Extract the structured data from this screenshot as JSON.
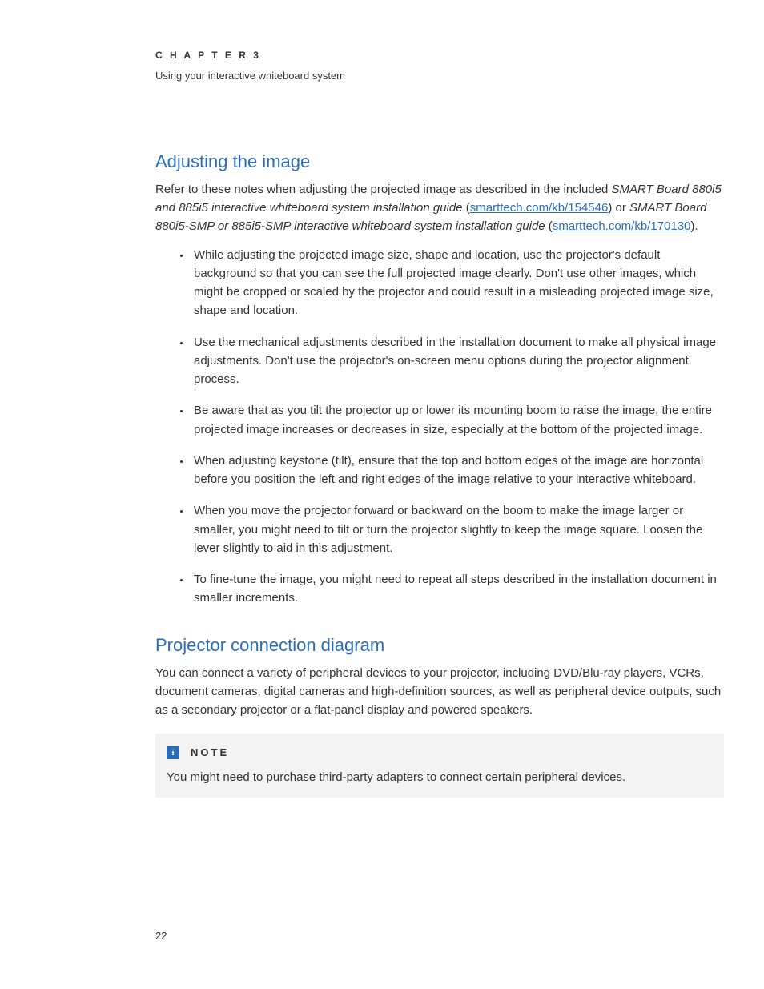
{
  "header": {
    "chapter_label": "C H A P T E R   3",
    "chapter_subtitle": "Using your interactive whiteboard system"
  },
  "section_adjusting": {
    "title": "Adjusting the image",
    "intro_pre": "Refer to these notes when adjusting the projected image as described in the included ",
    "intro_italic_1": "SMART Board 880i5 and 885i5 interactive whiteboard system installation guide",
    "intro_open_paren": " (",
    "link1_text": "smarttech.com/kb/154546",
    "intro_after_link1": ") or ",
    "intro_italic_2": "SMART Board 880i5-SMP or 885i5-SMP interactive whiteboard system installation guide",
    "intro_open_paren2": " (",
    "link2_text": "smarttech.com/kb/170130",
    "intro_after_link2": ").",
    "bullets": [
      "While adjusting the projected image size, shape and location, use the projector's default background so that you can see the full projected image clearly. Don't use other images, which might be cropped or scaled by the projector and could result in a misleading projected image size, shape and location.",
      "Use the mechanical adjustments described in the installation document to make all physical image adjustments. Don't use the projector's on-screen menu options during the projector alignment process.",
      "Be aware that as you tilt the projector up or lower its mounting boom to raise the image, the entire projected image increases or decreases in size, especially at the bottom of the projected image.",
      "When adjusting keystone (tilt), ensure that the top and bottom edges of the image are horizontal before you position the left and right edges of the image relative to your interactive whiteboard.",
      "When you move the projector forward or backward on the boom to make the image larger or smaller, you might need to tilt or turn the projector slightly to keep the image square. Loosen the lever slightly to aid in this adjustment.",
      "To fine-tune the image, you might need to repeat all steps described in the installation document in smaller increments."
    ]
  },
  "section_diagram": {
    "title": "Projector connection diagram",
    "intro": "You can connect a variety of peripheral devices to your projector, including DVD/Blu-ray players, VCRs, document cameras, digital cameras and high-definition sources, as well as peripheral device outputs, such as a secondary projector or a flat-panel display and powered speakers."
  },
  "note": {
    "icon_glyph": "i",
    "label": "NOTE",
    "body": "You might need to purchase third-party adapters to connect certain peripheral devices."
  },
  "page_number": "22"
}
